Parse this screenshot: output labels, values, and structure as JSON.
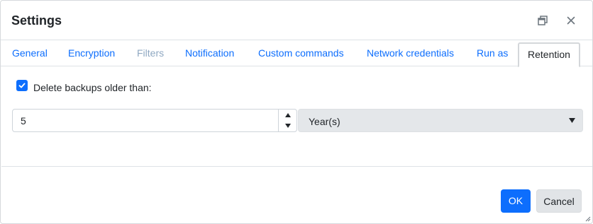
{
  "window": {
    "title": "Settings",
    "restore_icon": "restore-window-icon",
    "close_icon": "close-icon"
  },
  "tabs": [
    {
      "label": "General",
      "state": "normal"
    },
    {
      "label": "Encryption",
      "state": "normal"
    },
    {
      "label": "Filters",
      "state": "disabled"
    },
    {
      "label": "Notification",
      "state": "normal"
    },
    {
      "label": "Custom commands",
      "state": "normal"
    },
    {
      "label": "Network credentials",
      "state": "normal"
    },
    {
      "label": "Run as",
      "state": "normal"
    },
    {
      "label": "Retention",
      "state": "active"
    }
  ],
  "retention": {
    "delete_checkbox_label": "Delete backups older than:",
    "delete_checked": true,
    "amount": "5",
    "unit_selected": "Year(s)"
  },
  "footer": {
    "ok_label": "OK",
    "cancel_label": "Cancel"
  },
  "colors": {
    "accent": "#0d6efd",
    "disabled_tab": "#8fa8c2",
    "select_bg": "#e4e7ea"
  }
}
